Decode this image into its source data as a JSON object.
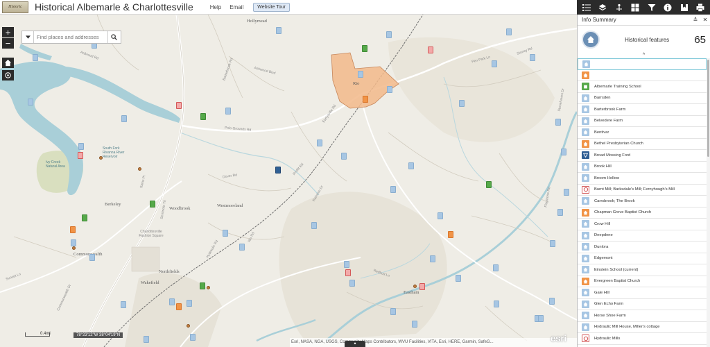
{
  "header": {
    "logo_text": "Historic Albemarle",
    "title": "Historical Albemarle & Charlottesville",
    "links": [
      "Help",
      "Email"
    ],
    "tour_button": "Website Tour"
  },
  "toolbar": {
    "icons": [
      "layer-list-icon",
      "layers-icon",
      "measure-icon",
      "basemap-gallery-icon",
      "filter-icon",
      "info-icon",
      "bookmark-icon",
      "print-icon"
    ]
  },
  "search": {
    "placeholder": "Find places and addresses"
  },
  "map": {
    "zoom_in": "+",
    "zoom_out": "−",
    "place_labels": [
      "Hollymead",
      "Woodbrook",
      "Westmoreland",
      "Berkeley",
      "Commonwealth",
      "Northfields",
      "Wakefield",
      "Rio",
      "Eastham",
      "Charlottesville Fashion Square",
      "South Fork Rivanna River Reservoir",
      "Ivy Creek Natural Area"
    ],
    "road_labels": [
      "Ardwood Rd",
      "Barterbrook Rd",
      "Ashwood Blvd",
      "Polo Grounds Rd",
      "Dover Rd",
      "Sams Pl",
      "Seminole Trl",
      "Proffit Rd",
      "Earlysville Rd",
      "Hydraulic Rd",
      "Rio Rd",
      "Redbud Ln",
      "Raintree Dr",
      "Flagstone Rd",
      "Pen Park Ln",
      "Stonehaven Dr",
      "Stoney Rd",
      "Commonwealth Dr",
      "Sunset Ln"
    ],
    "scale_label": "0.4mi",
    "coordinates": "78°23'12\"W 38°04'19\"N",
    "attribution": "Esri, NASA, NGA, USGS, Community Maps Contributors, WVU Facilities, VITA, Esri, HERE, Garmin, SafeG...",
    "attribution_toggle": "▴",
    "esri_logo": "esri"
  },
  "panel": {
    "title": "Info Summary",
    "summary_label": "Historical features",
    "summary_count": "65",
    "collapse_arrow": "^",
    "features": [
      {
        "name": "",
        "icon": "house"
      },
      {
        "name": "",
        "icon": "orange"
      },
      {
        "name": "Albemarle Training School",
        "icon": "green"
      },
      {
        "name": "Barrsden",
        "icon": "house"
      },
      {
        "name": "Barterbrook Farm",
        "icon": "house"
      },
      {
        "name": "Belvedere Farm",
        "icon": "house"
      },
      {
        "name": "Bentivar",
        "icon": "house"
      },
      {
        "name": "Bethel Presbyterian Church",
        "icon": "orange"
      },
      {
        "name": "Broad Mossing Ford",
        "icon": "navy"
      },
      {
        "name": "Brook Hill",
        "icon": "house"
      },
      {
        "name": "Broom Hollow",
        "icon": "house"
      },
      {
        "name": "Burnt Mill; Barksdale's Mill; Fernyhough's Mill",
        "icon": "red"
      },
      {
        "name": "Carrsbrook; The Brook",
        "icon": "house"
      },
      {
        "name": "Chapman Grove Baptist Church",
        "icon": "orange"
      },
      {
        "name": "Crow Hill",
        "icon": "house"
      },
      {
        "name": "Deepdene",
        "icon": "house"
      },
      {
        "name": "Dunlora",
        "icon": "house"
      },
      {
        "name": "Edgemont",
        "icon": "house"
      },
      {
        "name": "Einstein School (current)",
        "icon": "house"
      },
      {
        "name": "Evergreen Baptist Church",
        "icon": "orange"
      },
      {
        "name": "Gale Hill",
        "icon": "house"
      },
      {
        "name": "Glen Echo Farm",
        "icon": "house"
      },
      {
        "name": "Horse Shoe Farm",
        "icon": "house"
      },
      {
        "name": "Hydraulic Mill House, Miller's cottage",
        "icon": "house"
      },
      {
        "name": "Hydraulic Mills",
        "icon": "red"
      }
    ]
  }
}
